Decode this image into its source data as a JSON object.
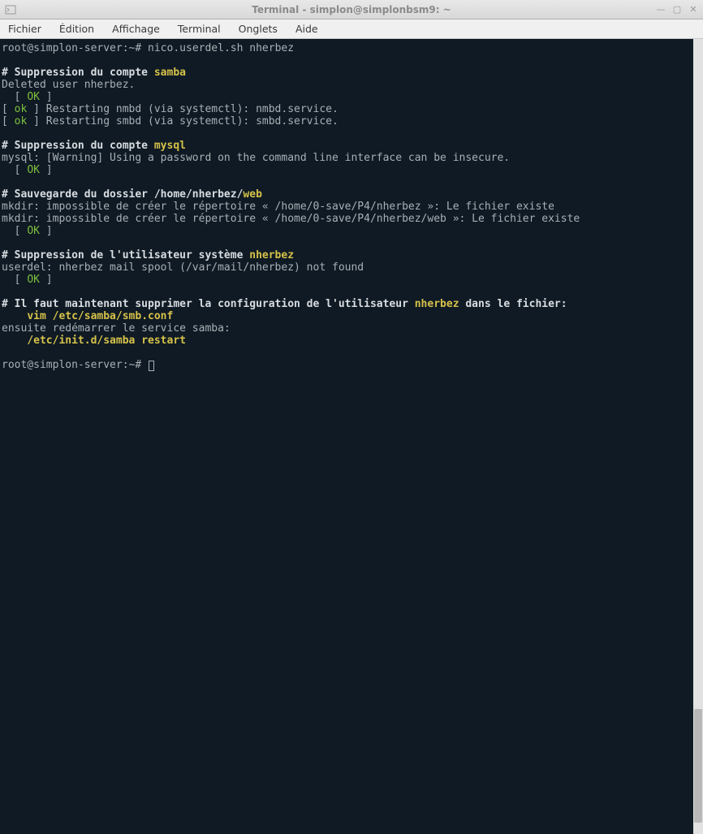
{
  "window": {
    "title": "Terminal - simplon@simplonbsm9: ~"
  },
  "menu": {
    "file": "Fichier",
    "edit": "Édition",
    "view": "Affichage",
    "terminal": "Terminal",
    "tabs": "Onglets",
    "help": "Aide"
  },
  "term": {
    "prompt1_user": "root@simplon-server",
    "prompt1_sep": ":",
    "prompt1_path": "~",
    "prompt1_hash": "# ",
    "cmd1": "nico.userdel.sh nherbez",
    "blank": "",
    "hdr1a": "# Suppression du compte ",
    "hdr1b": "samba",
    "l1": "Deleted user nherbez.",
    "ok_open": "  [ ",
    "ok": "OK",
    "ok_close": " ]",
    "ok2_open": "[ ",
    "ok2": "ok",
    "ok2_close": " ] Restarting nmbd (via systemctl): nmbd.service.",
    "ok3_open": "[ ",
    "ok3": "ok",
    "ok3_close": " ] Restarting smbd (via systemctl): smbd.service.",
    "hdr2a": "# Suppression du compte ",
    "hdr2b": "mysql",
    "l2": "mysql: [Warning] Using a password on the command line interface can be insecure.",
    "hdr3a": "# Sauvegarde du dossier /home/nherbez/",
    "hdr3b": "web",
    "l3": "mkdir: impossible de créer le répertoire « /home/0-save/P4/nherbez »: Le fichier existe",
    "l4": "mkdir: impossible de créer le répertoire « /home/0-save/P4/nherbez/web »: Le fichier existe",
    "hdr4a": "# Suppression de l'utilisateur système ",
    "hdr4b": "nherbez",
    "l5": "userdel: nherbez mail spool (/var/mail/nherbez) not found",
    "hdr5a": "# Il faut maintenant supprimer la configuration de l'utilisateur ",
    "hdr5b": "nherbez",
    "hdr5c": " dans le fichier:",
    "cmd2pad": "    ",
    "cmd2": "vim /etc/samba/smb.conf",
    "l6": "ensuite redémarrer le service samba:",
    "cmd3pad": "    ",
    "cmd3": "/etc/init.d/samba restart",
    "prompt2_user": "root@simplon-server",
    "prompt2_sep": ":",
    "prompt2_path": "~",
    "prompt2_hash": "# "
  }
}
